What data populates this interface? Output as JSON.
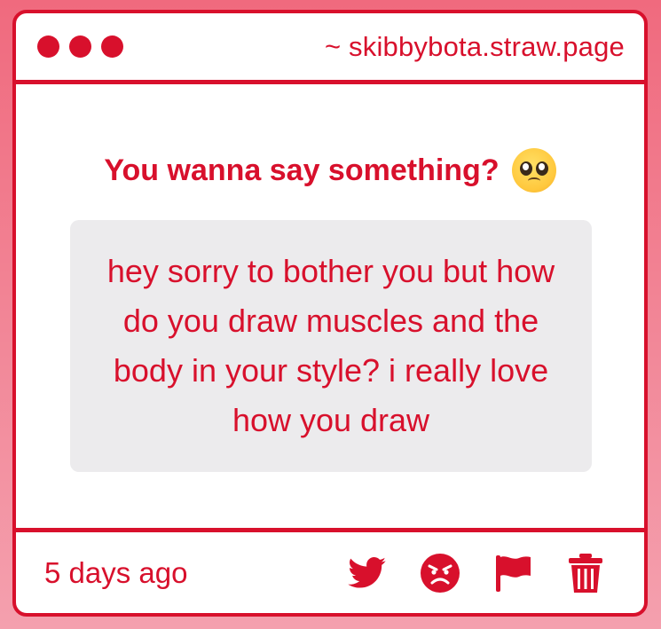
{
  "window": {
    "url": "~ skibbybota.straw.page"
  },
  "main": {
    "prompt": "You wanna say something?",
    "prompt_emoji": "pleading-face",
    "message": "hey sorry to bother you but how do you draw muscles and the body in your style? i really love how you draw"
  },
  "footer": {
    "timestamp": "5 days ago",
    "actions": [
      "twitter-icon",
      "angry-face-icon",
      "flag-icon",
      "trash-icon"
    ]
  },
  "colors": {
    "accent": "#d8102c",
    "message_bg": "#ecebed",
    "page_bg_top": "#f06a7e",
    "page_bg_bottom": "#f4a0ae"
  }
}
